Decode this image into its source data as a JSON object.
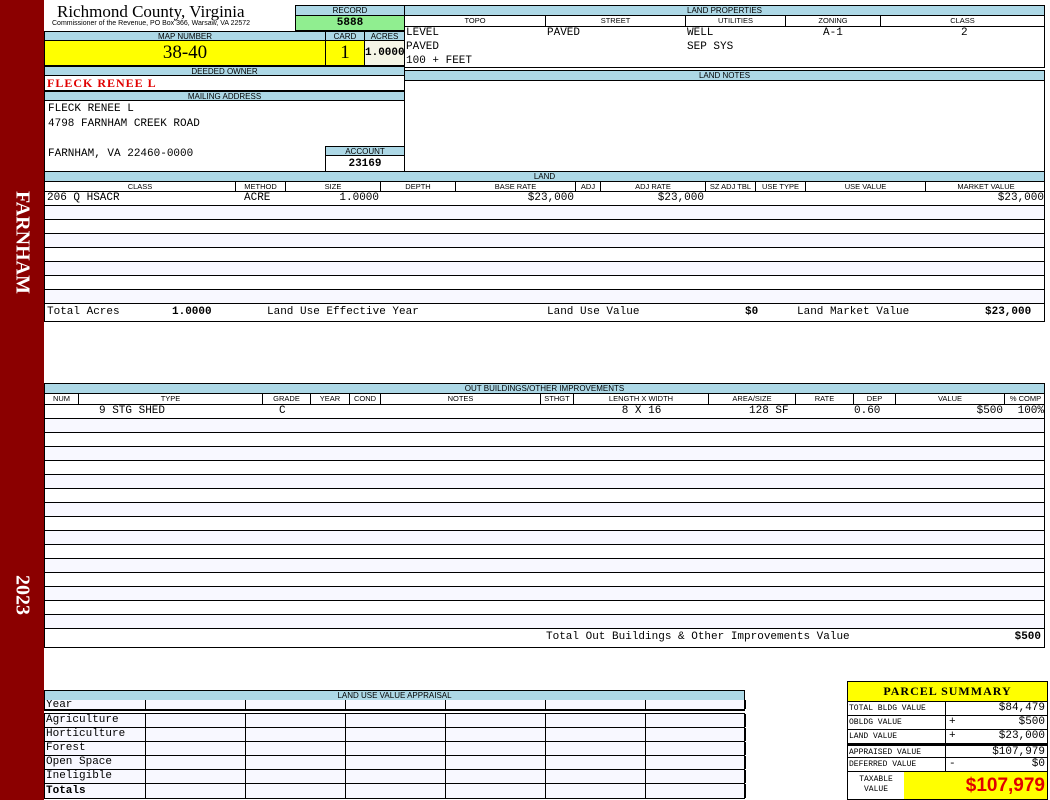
{
  "sidebar": {
    "location": "FARNHAM",
    "year": "2023"
  },
  "header": {
    "title": "Richmond County, Virginia",
    "subtitle": "Commissioner of the Revenue, PO Box 366, Warsaw, VA 22572"
  },
  "record": {
    "label": "RECORD",
    "value": "5888"
  },
  "map": {
    "map_label": "MAP NUMBER",
    "map_value": "38-40",
    "card_label": "CARD",
    "card_value": "1",
    "acres_label": "ACRES",
    "acres_value": "1.0000"
  },
  "owner": {
    "label": "DEEDED OWNER",
    "name": "FLECK RENEE L"
  },
  "mailing": {
    "label": "MAILING ADDRESS",
    "line1": "FLECK RENEE L",
    "line2": "4798 FARNHAM CREEK ROAD",
    "line3": "FARNHAM, VA 22460-0000"
  },
  "account": {
    "label": "ACCOUNT",
    "value": "23169"
  },
  "land_properties": {
    "label": "LAND PROPERTIES",
    "columns": [
      "TOPO",
      "STREET",
      "UTILITIES",
      "ZONING",
      "CLASS"
    ],
    "topo": [
      "LEVEL",
      "PAVED",
      "100 + FEET"
    ],
    "street": [
      "PAVED"
    ],
    "utilities": [
      "WELL",
      "SEP SYS"
    ],
    "zoning": [
      "A-1"
    ],
    "class": [
      "2"
    ]
  },
  "land_notes": {
    "label": "LAND NOTES"
  },
  "land": {
    "label": "LAND",
    "columns": [
      "CLASS",
      "METHOD",
      "SIZE",
      "DEPTH",
      "BASE RATE",
      "ADJ",
      "ADJ RATE",
      "SZ ADJ TBL",
      "USE TYPE",
      "USE VALUE",
      "MARKET VALUE"
    ],
    "rows": [
      [
        "206 Q HSACR",
        "ACRE",
        "1.0000",
        "",
        "$23,000",
        "",
        "$23,000",
        "",
        "",
        "",
        "$23,000"
      ]
    ],
    "totals": {
      "acres_label": "Total Acres",
      "acres": "1.0000",
      "use_year_label": "Land Use Effective Year",
      "use_value_label": "Land Use Value",
      "use_value": "$0",
      "market_label": "Land Market Value",
      "market": "$23,000"
    }
  },
  "outbuildings": {
    "label": "OUT BUILDINGS/OTHER IMPROVEMENTS",
    "columns": [
      "NUM",
      "TYPE",
      "GRADE",
      "YEAR",
      "COND",
      "NOTES",
      "STHGT",
      "LENGTH X WIDTH",
      "AREA/SIZE",
      "RATE",
      "DEP",
      "VALUE",
      "% COMP"
    ],
    "rows": [
      [
        "",
        "9 STG SHED",
        "C",
        "",
        "",
        "",
        "",
        "8 X 16",
        "128 SF",
        "",
        "0.60",
        "$500",
        "100%"
      ]
    ],
    "total_label": "Total Out Buildings & Other Improvements Value",
    "total": "$500"
  },
  "land_use": {
    "label": "LAND USE VALUE APPRAISAL",
    "year_label": "Year",
    "rows": [
      "Agriculture",
      "Horticulture",
      "Forest",
      "Open Space",
      "Ineligible"
    ],
    "totals_label": "Totals"
  },
  "summary": {
    "title": "PARCEL SUMMARY",
    "rows": [
      {
        "label": "TOTAL BLDG VALUE",
        "sign": "",
        "value": "$84,479"
      },
      {
        "label": "OBLDG VALUE",
        "sign": "+",
        "value": "$500"
      },
      {
        "label": "LAND VALUE",
        "sign": "+",
        "value": "$23,000"
      },
      {
        "label": "APPRAISED VALUE",
        "sign": "",
        "value": "$107,979"
      },
      {
        "label": "DEFERRED VALUE",
        "sign": "-",
        "value": "$0"
      }
    ],
    "taxable_label": "TAXABLE VALUE",
    "taxable": "$107,979"
  },
  "colors": {
    "sidebar": "#8b0000",
    "header": "#add8e6",
    "highlight": "#ffff00",
    "record": "#90ee90",
    "owner": "#e00000"
  }
}
